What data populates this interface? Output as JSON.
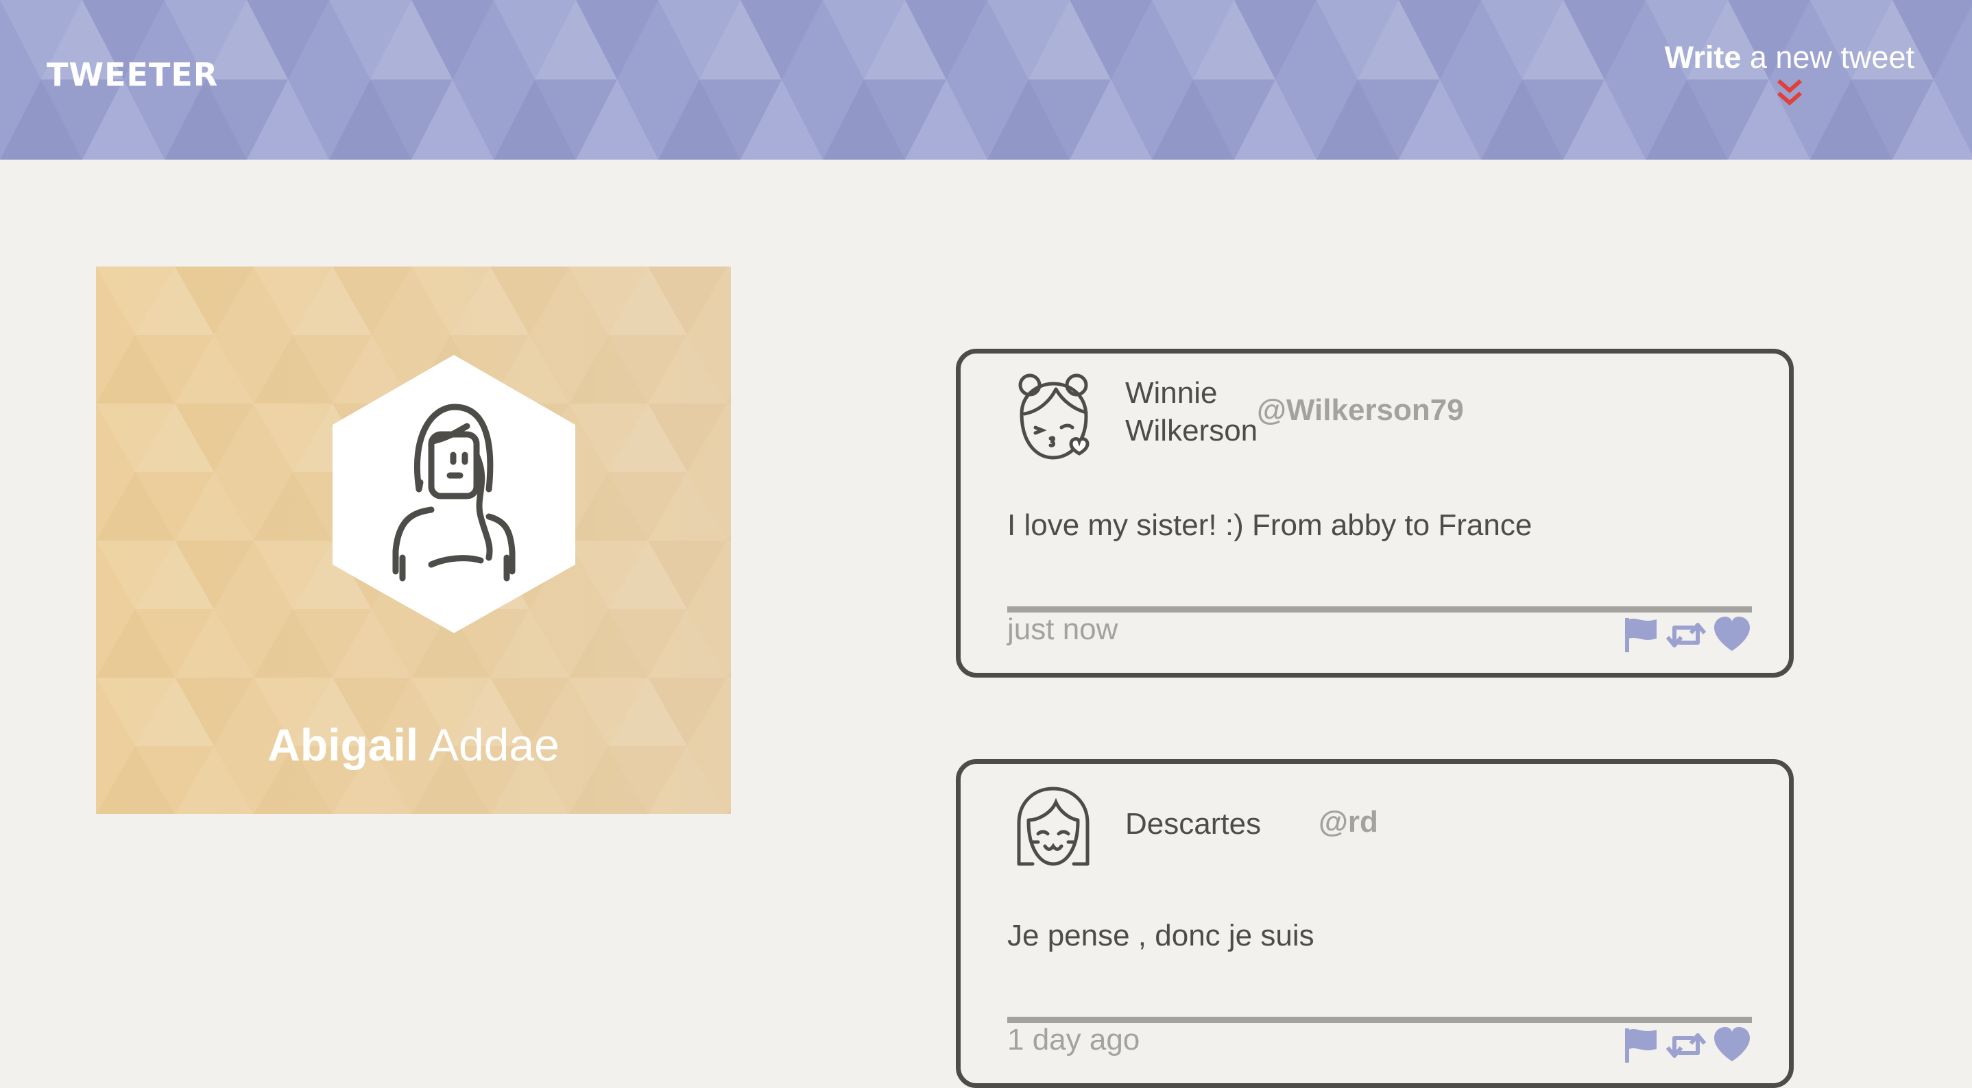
{
  "nav": {
    "brand": "TWEETER",
    "compose_strong": "Write",
    "compose_rest": " a new tweet",
    "compose_icon": "double-chevron-down-icon"
  },
  "colors": {
    "header": "#9ca2d0",
    "profile_card": "#eccf9c",
    "accent": "#e0403a",
    "text": "#4d4c48",
    "muted": "#a3a29e",
    "action_icons": "#9ca2d0",
    "background": "#f2f1ed"
  },
  "profile": {
    "first_name": "Abigail",
    "last_name": " Addae",
    "avatar_icon": "woman-avatar-icon"
  },
  "tweets": [
    {
      "name_line1": "Winnie",
      "name_line2": "Wilkerson",
      "handle": "@Wilkerson79",
      "text": "I love my sister! :) From abby to France",
      "time": "just now",
      "avatar_icon": "girl-kissing-avatar-icon",
      "actions": [
        "flag-icon",
        "retweet-icon",
        "heart-icon"
      ]
    },
    {
      "name_line1": "Descartes",
      "handle": "@rd",
      "text": "Je pense , donc je suis",
      "time": "1 day ago",
      "avatar_icon": "smiling-girl-avatar-icon",
      "actions": [
        "flag-icon",
        "retweet-icon",
        "heart-icon"
      ]
    }
  ]
}
